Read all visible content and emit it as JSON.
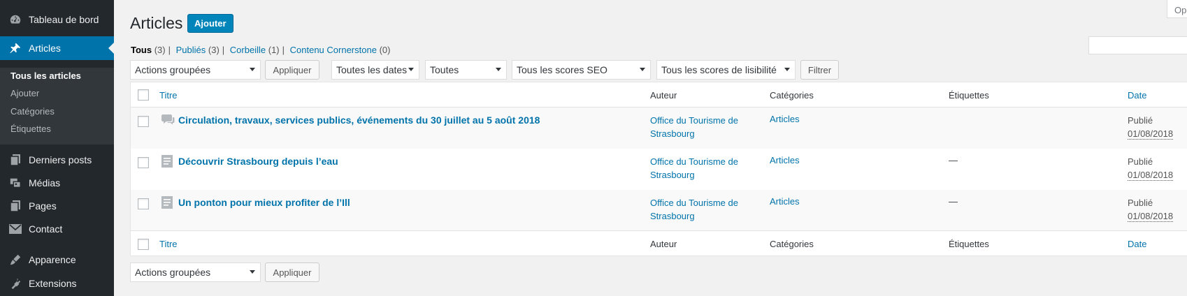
{
  "sidebar": {
    "items": [
      {
        "label": "Tableau de bord",
        "icon": "dashboard-icon"
      },
      {
        "label": "Articles",
        "icon": "pin-icon",
        "active": true
      },
      {
        "label": "Derniers posts",
        "icon": "posts-icon"
      },
      {
        "label": "Médias",
        "icon": "media-icon"
      },
      {
        "label": "Pages",
        "icon": "pages-icon"
      },
      {
        "label": "Contact",
        "icon": "mail-icon"
      },
      {
        "label": "Apparence",
        "icon": "appearance-icon"
      },
      {
        "label": "Extensions",
        "icon": "plugins-icon"
      }
    ],
    "submenu": [
      "Tous les articles",
      "Ajouter",
      "Catégories",
      "Étiquettes"
    ]
  },
  "header": {
    "title": "Articles",
    "add_label": "Ajouter",
    "screen_options": "Op"
  },
  "views": [
    {
      "label": "Tous",
      "count": "(3)"
    },
    {
      "label": "Publiés",
      "count": "(3)"
    },
    {
      "label": "Corbeille",
      "count": "(1)"
    },
    {
      "label": "Contenu Cornerstone",
      "count": "(0)"
    }
  ],
  "filters": {
    "bulk_actions": "Actions groupées",
    "apply": "Appliquer",
    "dates": "Toutes les dates",
    "categories": "Toutes",
    "seo": "Tous les scores SEO",
    "readability": "Tous les scores de lisibilité",
    "filter": "Filtrer"
  },
  "table": {
    "columns": {
      "title": "Titre",
      "author": "Auteur",
      "categories": "Catégories",
      "tags": "Étiquettes",
      "date": "Date"
    },
    "rows": [
      {
        "title": "Circulation, travaux, services publics, événements du 30 juillet au 5 août 2018",
        "format_icon": "chat-icon",
        "author_line1": "Office du Tourisme de",
        "author_line2": "Strasbourg",
        "category": "Articles",
        "tags": "",
        "status": "Publié",
        "date": "01/08/2018"
      },
      {
        "title": "Découvrir Strasbourg depuis l’eau",
        "format_icon": "post-icon",
        "author_line1": "Office du Tourisme de",
        "author_line2": "Strasbourg",
        "category": "Articles",
        "tags": "—",
        "status": "Publié",
        "date": "01/08/2018"
      },
      {
        "title": "Un ponton pour mieux profiter de l’Ill",
        "format_icon": "post-icon",
        "author_line1": "Office du Tourisme de",
        "author_line2": "Strasbourg",
        "category": "Articles",
        "tags": "—",
        "status": "Publié",
        "date": "01/08/2018"
      }
    ]
  },
  "bottom": {
    "bulk_actions": "Actions groupées",
    "apply": "Appliquer"
  }
}
